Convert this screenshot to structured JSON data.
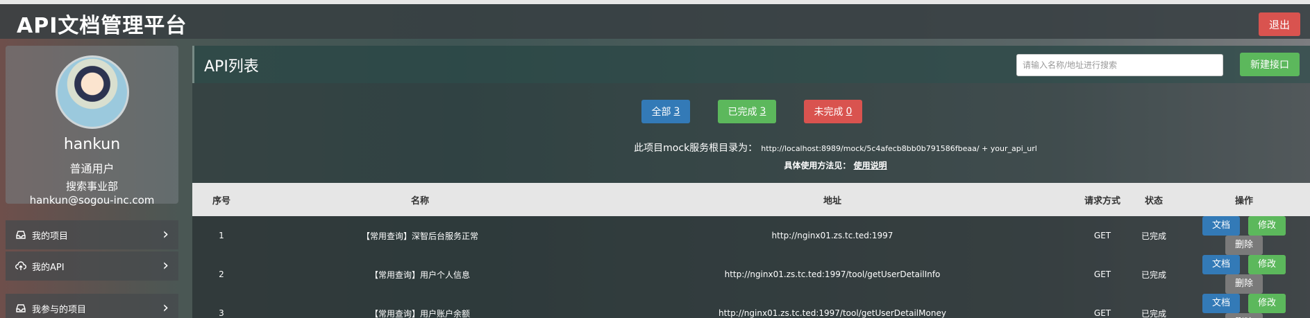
{
  "app": {
    "title": "API文档管理平台",
    "logout_label": "退出"
  },
  "profile": {
    "username": "hankun",
    "role": "普通用户",
    "department": "搜索事业部",
    "email": "hankun@sogou-inc.com"
  },
  "nav": {
    "items": [
      {
        "label": "我的项目",
        "icon": "inbox-icon"
      },
      {
        "label": "我的API",
        "icon": "cloud-upload-icon"
      },
      {
        "label": "我参与的项目",
        "icon": "inbox-icon"
      }
    ]
  },
  "main": {
    "title": "API列表",
    "search_placeholder": "请输入名称/地址进行搜索",
    "new_label": "新建接口",
    "filters": {
      "all": {
        "label": "全部",
        "count": "3"
      },
      "done": {
        "label": "已完成",
        "count": "3"
      },
      "todo": {
        "label": "未完成",
        "count": "0"
      }
    },
    "mock": {
      "label": "此项目mock服务根目录为：",
      "url": "http://localhost:8989/mock/5c4afecb8bb0b791586fbeaa/ + your_api_url"
    },
    "usage": {
      "label": "具体使用方法见：",
      "link": "使用说明"
    }
  },
  "table": {
    "headers": [
      "序号",
      "名称",
      "地址",
      "请求方式",
      "状态",
      "操作"
    ],
    "actions": {
      "doc": "文档",
      "edit": "修改",
      "delete": "删除"
    },
    "rows": [
      {
        "no": "1",
        "name": "【常用查询】深智后台服务正常",
        "addr": "http://nginx01.zs.tc.ted:1997",
        "method": "GET",
        "status": "已完成"
      },
      {
        "no": "2",
        "name": "【常用查询】用户个人信息",
        "addr": "http://nginx01.zs.tc.ted:1997/tool/getUserDetailInfo",
        "method": "GET",
        "status": "已完成"
      },
      {
        "no": "3",
        "name": "【常用查询】用户账户余额",
        "addr": "http://nginx01.zs.tc.ted:1997/tool/getUserDetailMoney",
        "method": "GET",
        "status": "已完成"
      }
    ]
  },
  "colors": {
    "primary": "#337ab7",
    "success": "#5cb85c",
    "danger": "#d9534f",
    "default": "#7a7a7a"
  }
}
